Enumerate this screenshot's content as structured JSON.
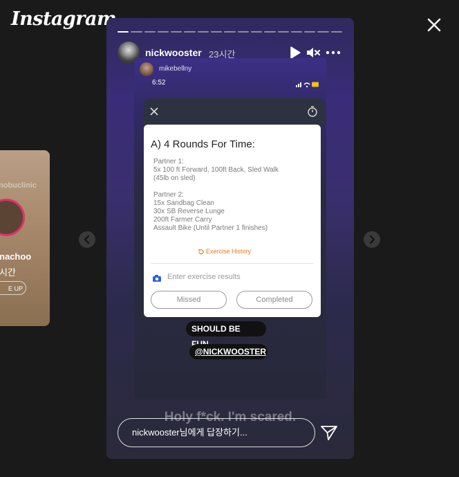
{
  "app": {
    "logo": "Instagram"
  },
  "preview": {
    "handle": "nobuclinic",
    "name": "nachoo",
    "time": "시간",
    "button": "E UP"
  },
  "story": {
    "progress": {
      "segments": 17,
      "current": 1
    },
    "header": {
      "username": "nickwooster",
      "time": "23시간",
      "icons": [
        "play-icon",
        "mute-icon",
        "more-icon"
      ]
    },
    "inner": {
      "username": "mikebellny",
      "clock": "6:52",
      "workout": {
        "title": "A) 4 Rounds For Time:",
        "lines": [
          "Partner 1:",
          "5x 100 ft Forward, 100ft Back, Sled Walk",
          "(45lb on sled)",
          "",
          "Partner 2:",
          "15x Sandbag Clean",
          "30x SB Reverse Lunge",
          "200ft Farmer Carry",
          "Assault Bike (Until Partner 1 finishes)"
        ],
        "history": "Exercise History",
        "input_placeholder": "Enter exercise results",
        "missed": "Missed",
        "completed": "Completed"
      },
      "stickers": [
        "SHOULD BE FUN...",
        "@NICKWOOSTER"
      ]
    },
    "caption": "Holy f*ck. I'm scared.",
    "reply_placeholder": "nickwooster님에게 답장하기..."
  },
  "colors": {
    "accent_ring": "#e1306c",
    "history": "#e07a28",
    "background": "#1a1a1a"
  }
}
